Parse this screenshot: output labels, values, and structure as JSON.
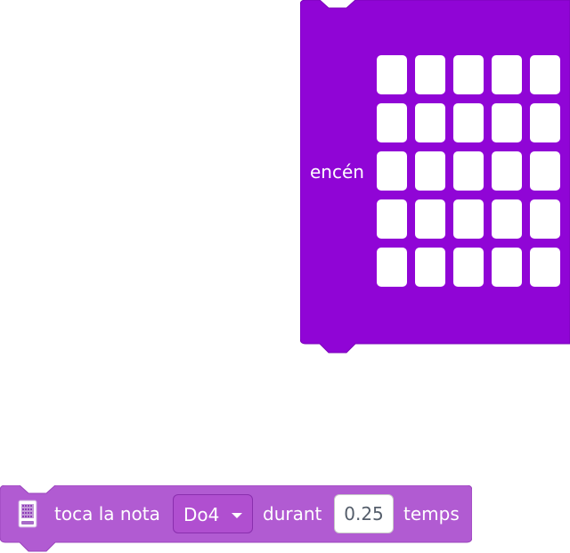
{
  "leds_block": {
    "label": "encén",
    "color": "#9005d6",
    "rows": 5,
    "cols": 5,
    "leds_on": 0
  },
  "tone_block": {
    "label_play": "toca la nota",
    "note_value": "Do4",
    "label_for": "durant",
    "duration_value": "0.25",
    "label_unit": "temps",
    "color": "#b15bd2",
    "icon": "microbit-extension-icon"
  }
}
